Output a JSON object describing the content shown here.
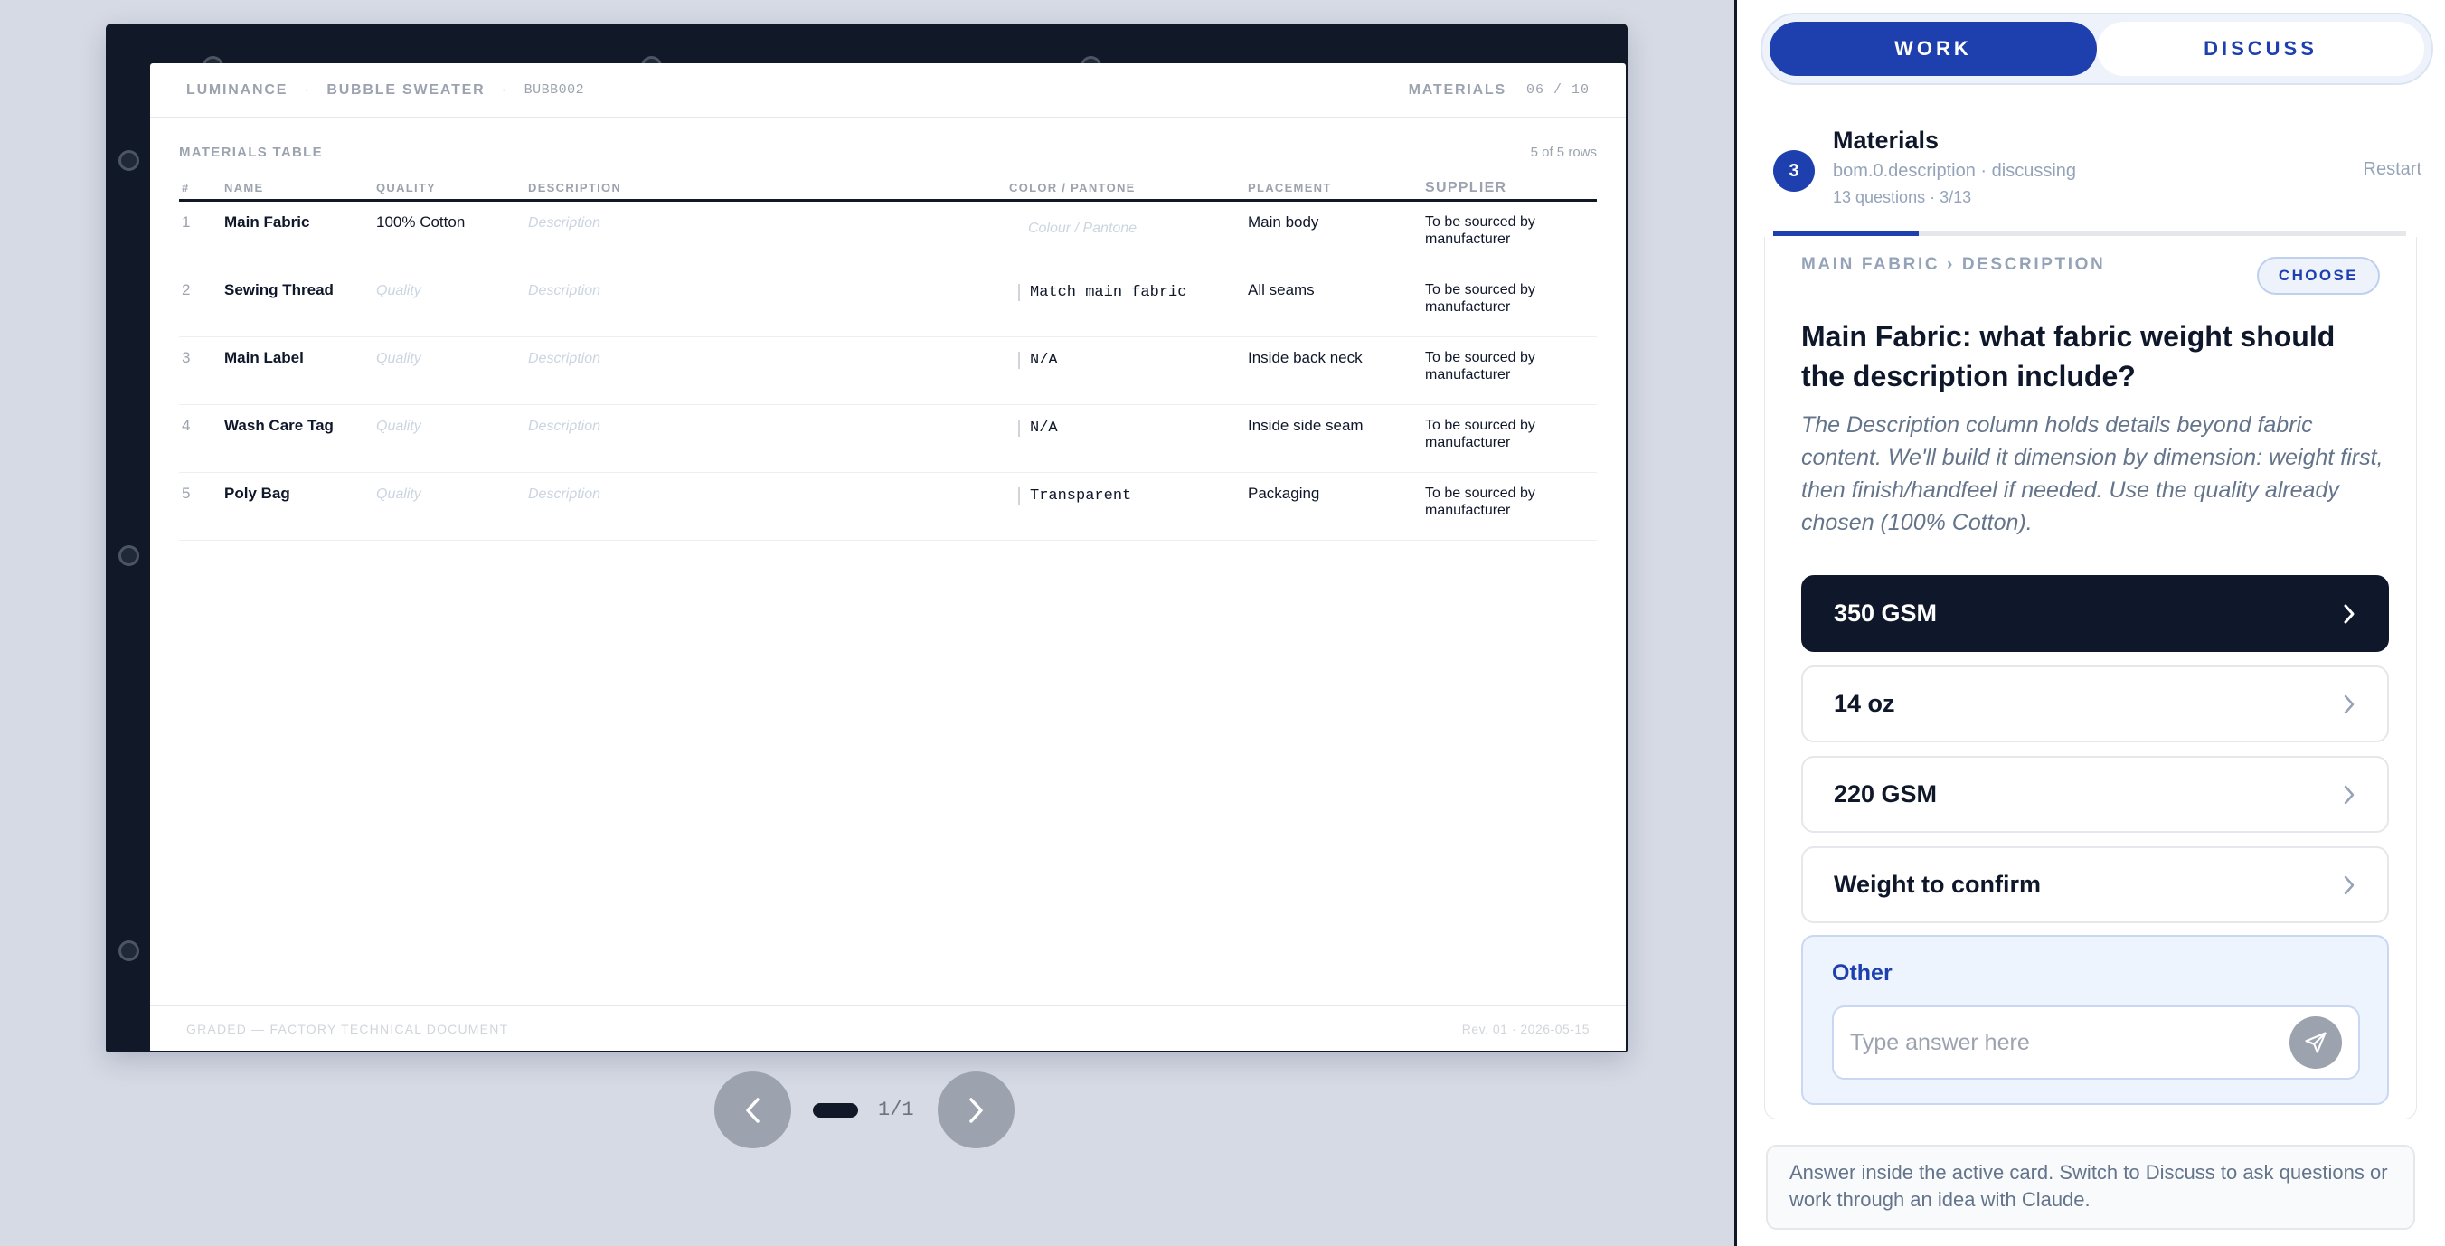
{
  "document": {
    "brand": "LUMINANCE",
    "product": "BUBBLE SWEATER",
    "code": "BUBB002",
    "section": "MATERIALS",
    "section_count": "06 / 10",
    "table_title": "MATERIALS TABLE",
    "row_count": "5 of 5 rows",
    "columns": [
      "#",
      "NAME",
      "QUALITY",
      "DESCRIPTION",
      "COLOR / PANTONE",
      "PLACEMENT",
      "SUPPLIER"
    ],
    "rows": [
      {
        "num": "1",
        "name": "Main Fabric",
        "quality": "100% Cotton",
        "description": "Description",
        "color": "Colour / Pantone",
        "placement": "Main body",
        "supplier": "To be sourced by manufacturer"
      },
      {
        "num": "2",
        "name": "Sewing Thread",
        "quality": "Quality",
        "description": "Description",
        "color": "Match main fabric",
        "placement": "All seams",
        "supplier": "To be sourced by manufacturer"
      },
      {
        "num": "3",
        "name": "Main Label",
        "quality": "Quality",
        "description": "Description",
        "color": "N/A",
        "placement": "Inside back neck",
        "supplier": "To be sourced by manufacturer"
      },
      {
        "num": "4",
        "name": "Wash Care Tag",
        "quality": "Quality",
        "description": "Description",
        "color": "N/A",
        "placement": "Inside side seam",
        "supplier": "To be sourced by manufacturer"
      },
      {
        "num": "5",
        "name": "Poly Bag",
        "quality": "Quality",
        "description": "Description",
        "color": "Transparent",
        "placement": "Packaging",
        "supplier": "To be sourced by manufacturer"
      }
    ],
    "footer_left": "GRADED — FACTORY TECHNICAL DOCUMENT",
    "footer_right": "Rev. 01 · 2026-05-15"
  },
  "pager": {
    "label": "1/1",
    "prev_icon": "chevron-left-icon",
    "next_icon": "chevron-right-icon"
  },
  "panel": {
    "tabs": {
      "work": "WORK",
      "discuss": "DISCUSS",
      "active": "work"
    },
    "step": "3",
    "section_title": "Materials",
    "section_sub": "bom.0.description · discussing",
    "section_meta": "13 questions · 3/13",
    "restart": "Restart",
    "progress": 0.23,
    "card": {
      "breadcrumb": "MAIN FABRIC › DESCRIPTION",
      "choose": "CHOOSE",
      "question": "Main Fabric: what fabric weight should the description include?",
      "help": "The Description column holds details beyond fabric content. We'll build it dimension by dimension: weight first, then finish/handfeel if needed. Use the quality already chosen (100% Cotton).",
      "options": [
        {
          "label": "350 GSM",
          "selected": true
        },
        {
          "label": "14 oz",
          "selected": false
        },
        {
          "label": "220 GSM",
          "selected": false
        },
        {
          "label": "Weight to confirm",
          "selected": false
        }
      ],
      "other_label": "Other",
      "other_placeholder": "Type answer here"
    },
    "hint": "Answer inside the active card. Switch to Discuss to ask questions or work through an idea with Claude."
  },
  "colors": {
    "accent": "#1e40af",
    "binder": "#111827",
    "selected_option": "#0f172a",
    "background": "#d5dae5"
  }
}
